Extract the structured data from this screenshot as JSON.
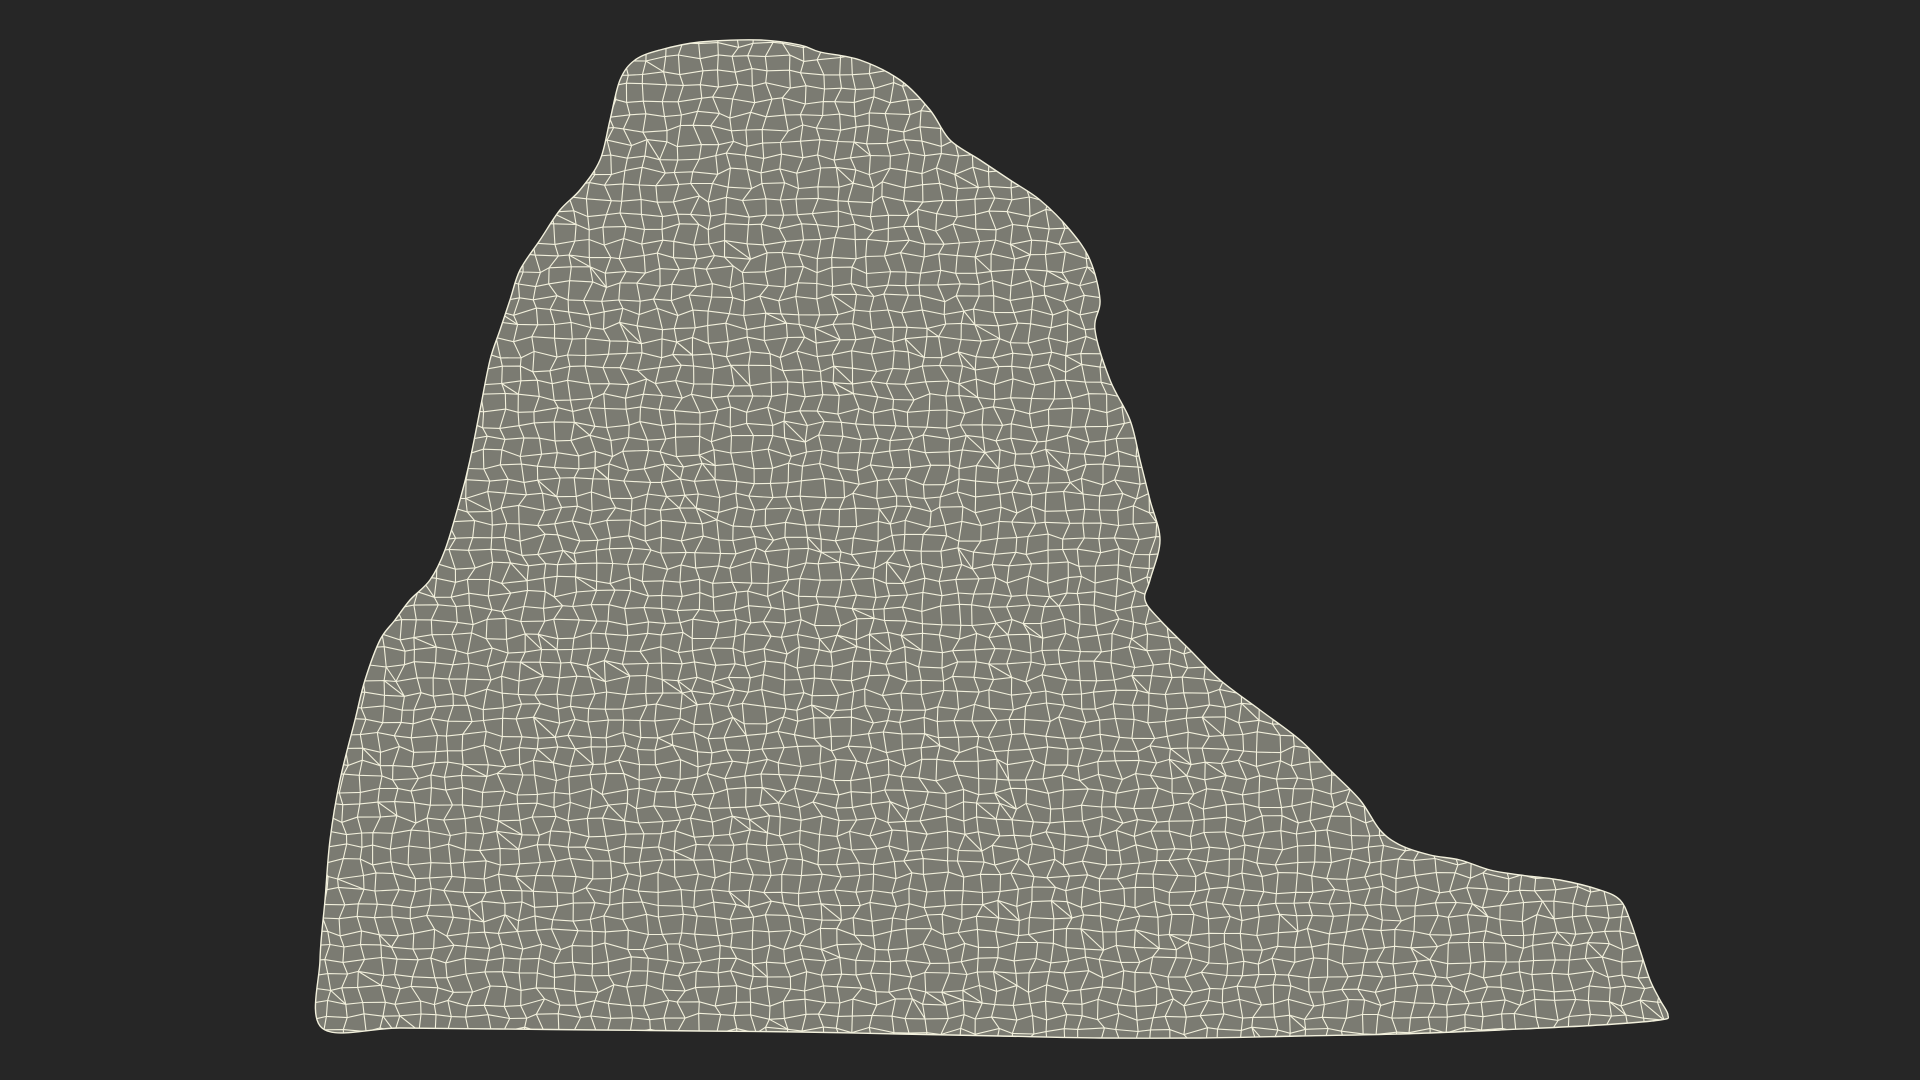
{
  "scene": {
    "subject": "rock-wireframe-mesh",
    "colors": {
      "background": "#262626",
      "mesh_fill": "#7b7b72",
      "wire": "#f2f0dc"
    }
  }
}
